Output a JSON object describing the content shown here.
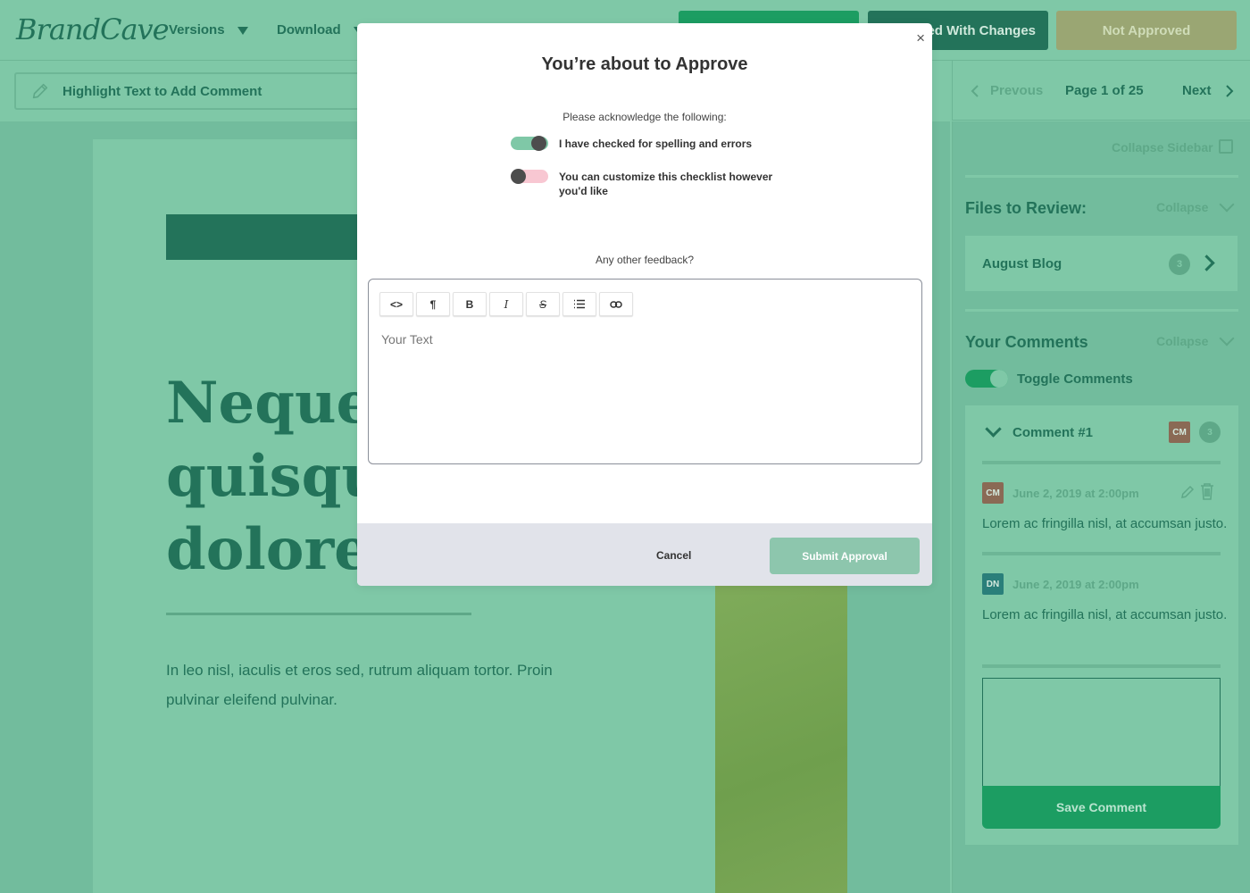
{
  "header": {
    "logo_text": "BrandCave",
    "nav": [
      {
        "label": "Versions"
      },
      {
        "label": "Download"
      }
    ],
    "actions": {
      "approved_with_changes": "Approved With Changes",
      "not_approved": "Not Approved"
    }
  },
  "toolbar": {
    "highlight_label": "Highlight Text to Add Comment"
  },
  "pager": {
    "previous": "Prevous",
    "page_label": "Page 1 of 25",
    "next": "Next"
  },
  "document": {
    "headline_lines": [
      "Neque p",
      "quisqua",
      "dolorem"
    ],
    "paragraph": "In leo nisl, iaculis et eros sed, rutrum aliquam tortor. Proin pulvinar eleifend pulvinar."
  },
  "sidebar": {
    "collapse_sidebar": "Collapse Sidebar",
    "files_title": "Files to Review:",
    "files_collapse": "Collapse",
    "file": {
      "name": "August Blog",
      "count": "3"
    },
    "comments_title": "Your Comments",
    "comments_collapse": "Collapse",
    "toggle_label": "Toggle Comments",
    "comment_thread": {
      "title": "Comment #1",
      "author_initials": "CM",
      "count": "3",
      "entries": [
        {
          "initials": "CM",
          "date": "June 2, 2019 at 2:00pm",
          "text": "Lorem ac fringilla nisl, at accumsan justo."
        },
        {
          "initials": "DN",
          "date": "June 2, 2019 at 2:00pm",
          "text": "Lorem ac fringilla nisl, at accumsan justo."
        }
      ]
    },
    "save_comment": "Save Comment"
  },
  "modal": {
    "title": "You’re about to Approve",
    "close": "×",
    "ack_label": "Please acknowledge the following:",
    "checklist": [
      {
        "text": "I have checked for spelling and errors",
        "checked": true
      },
      {
        "text": "You can customize this checklist however you'd like",
        "checked": false
      }
    ],
    "feedback_label": "Any other feedback?",
    "editor": {
      "toolbar": [
        "<>",
        "¶",
        "B",
        "I",
        "S",
        "list",
        "link"
      ],
      "placeholder": "Your Text",
      "value": ""
    },
    "cancel": "Cancel",
    "submit": "Submit Approval"
  },
  "colors": {
    "overlay_green": "#7fc8a7",
    "brand_dark": "#23735a",
    "accent_green": "#1c9d62",
    "toggle_off_pink": "#f8c7d2",
    "footer_gray": "#e1e3ea",
    "submit_disabled": "#8dc6ad",
    "avatar_cm": "#8a6a55",
    "avatar_dn": "#2a7f7a"
  }
}
